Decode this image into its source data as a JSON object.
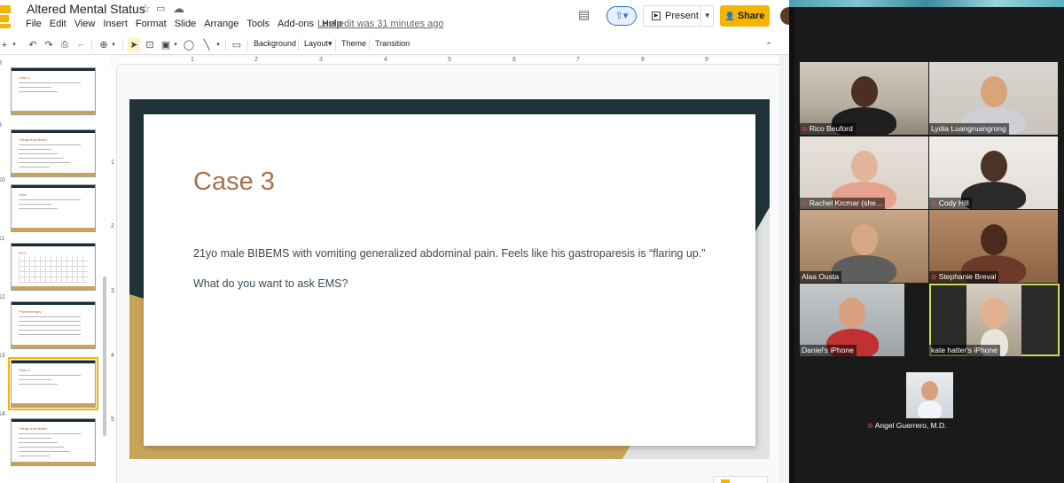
{
  "app": {
    "doc_title": "Altered Mental Status",
    "menu": [
      "File",
      "Edit",
      "View",
      "Insert",
      "Format",
      "Slide",
      "Arrange",
      "Tools",
      "Add-ons",
      "Help"
    ],
    "last_edit": "Last edit was 31 minutes ago",
    "present_label": "Present",
    "share_label": "Share"
  },
  "toolbar": {
    "background_label": "Background",
    "layout_label": "Layout",
    "theme_label": "Theme",
    "transition_label": "Transition"
  },
  "ruler": {
    "h_marks": [
      "1",
      "2",
      "3",
      "4",
      "5",
      "6",
      "7",
      "8",
      "9"
    ],
    "v_marks": [
      "1",
      "2",
      "3",
      "4",
      "5"
    ]
  },
  "filmstrip": {
    "slides": [
      {
        "number": "8",
        "title": "Case 2",
        "kind": "text",
        "selected": false
      },
      {
        "number": "9",
        "title": "Things that Matter",
        "kind": "list",
        "selected": false
      },
      {
        "number": "10",
        "title": "Labs",
        "kind": "text",
        "selected": false
      },
      {
        "number": "11",
        "title": "EKG",
        "kind": "grid",
        "selected": false
      },
      {
        "number": "12",
        "title": "Physiotherapy",
        "kind": "table",
        "selected": false
      },
      {
        "number": "13",
        "title": "Case 3",
        "kind": "text",
        "selected": true
      },
      {
        "number": "14",
        "title": "Things that Matter",
        "kind": "list",
        "selected": false
      }
    ]
  },
  "slide": {
    "title": "Case 3",
    "body_line1": "21yo male BIBEMS with vomiting generalized abdominal pain. Feels like his gastroparesis is “flaring up.”",
    "body_line2": "What do you want to ask EMS?"
  },
  "zoom": {
    "participants": [
      {
        "name": "Rico Beuford",
        "muted": true,
        "active": false
      },
      {
        "name": "Lydia Luangruangrong",
        "muted": false,
        "active": false
      },
      {
        "name": "Rachel Krcmar (she...",
        "muted": true,
        "active": false
      },
      {
        "name": "Cody Hill",
        "muted": true,
        "active": false
      },
      {
        "name": "Alaa Ousta",
        "muted": false,
        "active": false
      },
      {
        "name": "Stephanie Breval",
        "muted": true,
        "active": false
      },
      {
        "name": "Daniel's iPhone",
        "muted": false,
        "active": false
      },
      {
        "name": "kate hatter's iPhone",
        "muted": false,
        "active": true
      },
      {
        "name": "Angel Guerrero, M.D.",
        "muted": true,
        "active": false
      }
    ]
  },
  "colors": {
    "slides_accent": "#f4b400",
    "slide_dark": "#1f3338",
    "slide_gold": "#c8a45a",
    "slide_title": "#a7704d",
    "zoom_active_border": "#c7e05a",
    "zoom_mute": "#e5484d"
  },
  "icons": [
    "star-icon",
    "folder-icon",
    "cloud-icon",
    "comment-icon",
    "present-icon",
    "lock-icon",
    "undo-icon",
    "redo-icon",
    "print-icon",
    "paint-format-icon",
    "zoom-icon",
    "cursor-icon",
    "textbox-icon",
    "image-icon",
    "shape-icon",
    "line-icon",
    "comment-add-icon",
    "collapse-icon",
    "mute-icon"
  ]
}
